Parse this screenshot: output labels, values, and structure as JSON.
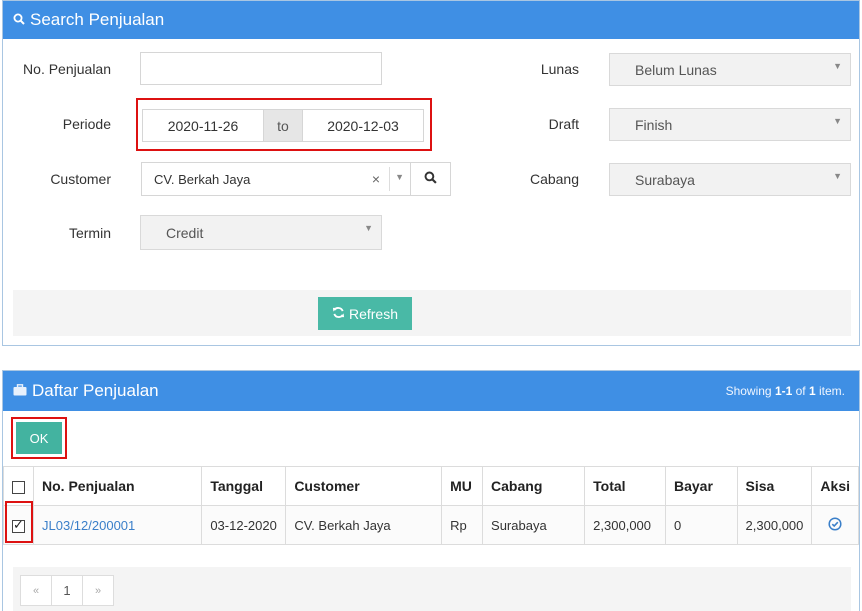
{
  "search": {
    "title": "Search Penjualan",
    "labels": {
      "no_penjualan": "No. Penjualan",
      "periode": "Periode",
      "customer": "Customer",
      "termin": "Termin",
      "lunas": "Lunas",
      "draft": "Draft",
      "cabang": "Cabang"
    },
    "no_penjualan_value": "",
    "periode_from": "2020-11-26",
    "periode_to_label": "to",
    "periode_to": "2020-12-03",
    "customer_value": "CV. Berkah Jaya",
    "customer_clear": "×",
    "termin_value": "Credit",
    "lunas_value": "Belum Lunas",
    "draft_value": "Finish",
    "cabang_value": "Surabaya",
    "refresh_label": "Refresh"
  },
  "list": {
    "title": "Daftar Penjualan",
    "showing_prefix": "Showing ",
    "showing_range": "1-1",
    "showing_mid": " of ",
    "showing_total": "1",
    "showing_suffix": " item.",
    "ok_label": "OK",
    "columns": [
      "No. Penjualan",
      "Tanggal",
      "Customer",
      "MU",
      "Cabang",
      "Total",
      "Bayar",
      "Sisa",
      "Aksi"
    ],
    "rows": [
      {
        "no": "JL03/12/200001",
        "tanggal": "03-12-2020",
        "customer": "CV. Berkah Jaya",
        "mu": "Rp",
        "cabang": "Surabaya",
        "total": "2,300,000",
        "bayar": "0",
        "sisa": "2,300,000"
      }
    ],
    "pager": {
      "prev": "«",
      "current": "1",
      "next": "»"
    }
  },
  "icons": {
    "search": "search-icon",
    "refresh": "refresh-icon",
    "briefcase": "briefcase-icon",
    "aksi": "check-circle-icon"
  }
}
